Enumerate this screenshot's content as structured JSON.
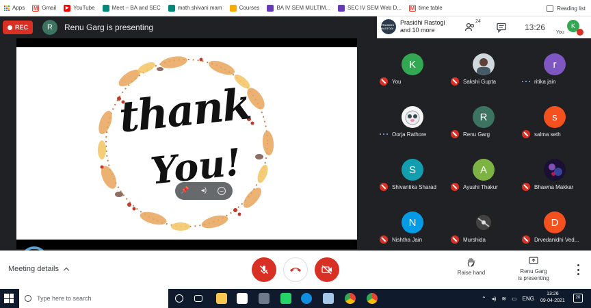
{
  "browser": {
    "bookmarks": [
      {
        "label": "Apps",
        "icon": "apps-grid-icon",
        "color": "#4285f4"
      },
      {
        "label": "Gmail",
        "icon": "gmail-icon",
        "color": "#ea4335"
      },
      {
        "label": "YouTube",
        "icon": "youtube-icon",
        "color": "#ff0000"
      },
      {
        "label": "Meet – BA and SEC",
        "icon": "meet-icon",
        "color": "#00897b"
      },
      {
        "label": "math shivani mam",
        "icon": "meet-icon",
        "color": "#00897b"
      },
      {
        "label": "Courses",
        "icon": "classroom-icon",
        "color": "#f9ab00"
      },
      {
        "label": "BA IV SEM MULTIM...",
        "icon": "forms-icon",
        "color": "#673ab7"
      },
      {
        "label": "SEC IV SEM Web D...",
        "icon": "forms-icon",
        "color": "#673ab7"
      },
      {
        "label": "time table",
        "icon": "gmail-icon",
        "color": "#ea4335"
      }
    ],
    "reading_list": "Reading list"
  },
  "meet": {
    "rec_label": "REC",
    "presenter_initial": "R",
    "presenting_title": "Renu Garg is presenting",
    "people_panel": {
      "avatar_text": "PRASIDHI RASTOGI",
      "name_line1": "Prasidhi Rastogi",
      "name_line2": "and 10 more",
      "people_count": "24",
      "time": "13:26",
      "you_initial": "K",
      "you_label": "You"
    },
    "slide": {
      "line1": "thank",
      "line2": "You!"
    },
    "participants": [
      {
        "name": "You",
        "initial": "K",
        "color": "#33a852",
        "status": "muted",
        "avatar": "letter"
      },
      {
        "name": "Sakshi Gupta",
        "initial": "",
        "color": "#9aa0a6",
        "status": "muted",
        "avatar": "photo"
      },
      {
        "name": "ritika jain",
        "initial": "r",
        "color": "#7e57c2",
        "status": "speaking",
        "avatar": "letter"
      },
      {
        "name": "Oorja Rathore",
        "initial": "",
        "color": "#e8eaed",
        "status": "speaking",
        "avatar": "photo"
      },
      {
        "name": "Renu Garg",
        "initial": "R",
        "color": "#3c7361",
        "status": "muted",
        "avatar": "letter"
      },
      {
        "name": "salma seth",
        "initial": "s",
        "color": "#f4511e",
        "status": "muted",
        "avatar": "letter"
      },
      {
        "name": "Shivantika Sharad",
        "initial": "S",
        "color": "#129eaf",
        "status": "muted",
        "avatar": "letter"
      },
      {
        "name": "Ayushi Thakur",
        "initial": "A",
        "color": "#7cb342",
        "status": "muted",
        "avatar": "letter"
      },
      {
        "name": "Bhawna Makkar",
        "initial": "",
        "color": "#4a3b6b",
        "status": "muted",
        "avatar": "photo"
      },
      {
        "name": "Nishtha Jain",
        "initial": "N",
        "color": "#039be5",
        "status": "muted",
        "avatar": "letter"
      },
      {
        "name": "Murshida",
        "initial": "",
        "color": "#2a2a2a",
        "status": "muted",
        "avatar": "photo"
      },
      {
        "name": "Drvedanidhi Ved...",
        "initial": "D",
        "color": "#f4511e",
        "status": "muted",
        "avatar": "letter"
      }
    ],
    "controls": {
      "meeting_details": "Meeting details",
      "raise_hand": "Raise hand",
      "presenting_line1": "Renu Garg",
      "presenting_line2": "is presenting"
    }
  },
  "taskbar": {
    "search_placeholder": "Type here to search",
    "language": "ENG",
    "time": "13:26",
    "date": "09-04-2021",
    "notifications": "20"
  }
}
